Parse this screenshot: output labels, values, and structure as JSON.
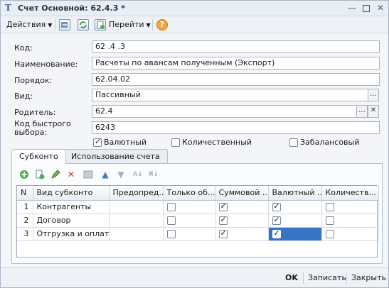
{
  "window": {
    "title": "Счет Основной: 62.4.3 *",
    "min_glyph": "—",
    "close_glyph": "✕",
    "app_icon_glyph": "Т"
  },
  "toolbar": {
    "actions_label": "Действия",
    "goto_label": "Перейти",
    "help_glyph": "?"
  },
  "form": {
    "code_label": "Код:",
    "code_value": "62 .4  .3",
    "name_label": "Наименование:",
    "name_value": "Расчеты по авансам полученным (Экспорт)",
    "order_label": "Порядок:",
    "order_value": "62.04.02",
    "kind_label": "Вид:",
    "kind_value": "Пассивный",
    "parent_label": "Родитель:",
    "parent_value": "62.4",
    "quick_code_label_1": "Код быстрого",
    "quick_code_label_2": "выбора:",
    "quick_code_value": "6243",
    "select_button": "...",
    "clear_button": "✕"
  },
  "flags": [
    {
      "label": "Валютный",
      "checked": true
    },
    {
      "label": "Количественный",
      "checked": false
    },
    {
      "label": "Забалансовый",
      "checked": false
    }
  ],
  "tabs": [
    {
      "label": "Субконто",
      "active": true
    },
    {
      "label": "Использование счета",
      "active": false
    }
  ],
  "grid_toolbar_icons": [
    "add-icon",
    "copy-icon",
    "edit-icon",
    "delete-icon",
    "end-edit-icon",
    "move-up-icon",
    "move-down-icon",
    "sort-asc-icon",
    "sort-desc-icon"
  ],
  "grid": {
    "columns": [
      "N",
      "Вид субконто",
      "Предопред...",
      "Только об...",
      "Суммовой ...",
      "Валютный ...",
      "Количеств..."
    ],
    "rows": [
      {
        "n": "1",
        "kind": "Контрагенты",
        "predef": "",
        "turnover_only": false,
        "sum": true,
        "currency": true,
        "quantity": false
      },
      {
        "n": "2",
        "kind": "Договор",
        "predef": "",
        "turnover_only": false,
        "sum": true,
        "currency": true,
        "quantity": false
      },
      {
        "n": "3",
        "kind": "Отгрузка и оплат...",
        "predef": "",
        "turnover_only": false,
        "sum": true,
        "currency": true,
        "quantity": false
      }
    ]
  },
  "buttons": {
    "ok": "OK",
    "save": "Записать",
    "close": "Закрыть"
  }
}
